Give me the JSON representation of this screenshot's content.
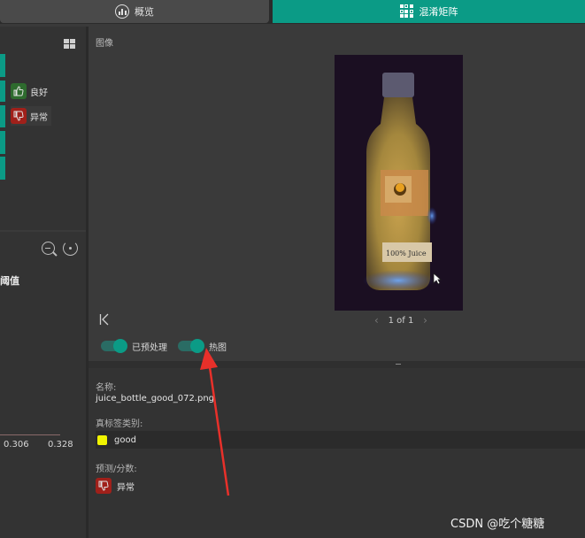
{
  "tabs": {
    "overview_label": "概览",
    "confusion_label": "混淆矩阵"
  },
  "legend": {
    "good_label": "良好",
    "bad_label": "异常"
  },
  "chart_panel": {
    "threshold_label": "阈值",
    "ticks": [
      "0.306",
      "0.328"
    ]
  },
  "image_panel": {
    "title": "图像",
    "page_label": "1 of 1",
    "toggle_preprocessed": "已预处理",
    "toggle_heatmap": "热图",
    "bottle_label_text": "100% Juice"
  },
  "info": {
    "name_label": "名称:",
    "name_value": "juice_bottle_good_072.png",
    "gt_label": "真标签类别:",
    "gt_value": "good",
    "gt_color": "#f1f400",
    "pred_label": "预测/分数:",
    "pred_value": "异常"
  },
  "colors": {
    "accent": "#0b9b86",
    "bad": "#a0201a",
    "good": "#2e6b2e",
    "annotation_arrow": "#e8302a"
  },
  "watermark": "CSDN @吃个糖糖"
}
